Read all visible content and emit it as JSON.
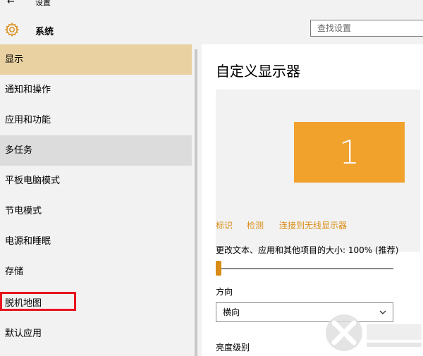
{
  "titlebar": {
    "title": "设置"
  },
  "header": {
    "title": "系统",
    "search_placeholder": "查找设置"
  },
  "sidebar": {
    "items": [
      {
        "label": "显示",
        "state": "selected"
      },
      {
        "label": "通知和操作"
      },
      {
        "label": "应用和功能"
      },
      {
        "label": "多任务",
        "state": "hover"
      },
      {
        "label": "平板电脑模式"
      },
      {
        "label": "节电模式"
      },
      {
        "label": "电源和睡眠"
      },
      {
        "label": "存储"
      },
      {
        "label": "脱机地图",
        "highlighted": true
      },
      {
        "label": "默认应用"
      }
    ]
  },
  "main": {
    "title": "自定义显示器",
    "monitor_number": "1",
    "links": {
      "identify": "标识",
      "detect": "检测",
      "connect": "连接到无线显示器"
    },
    "scale_label": "更改文本、应用和其他项目的大小: 100% (推荐)",
    "scale_percent": 100,
    "orientation_label": "方向",
    "orientation_value": "横向",
    "brightness_label": "亮度级别"
  },
  "colors": {
    "accent": "#f0a22d",
    "selected_bg": "#e9d1a1",
    "highlight_border": "#e8141f"
  }
}
